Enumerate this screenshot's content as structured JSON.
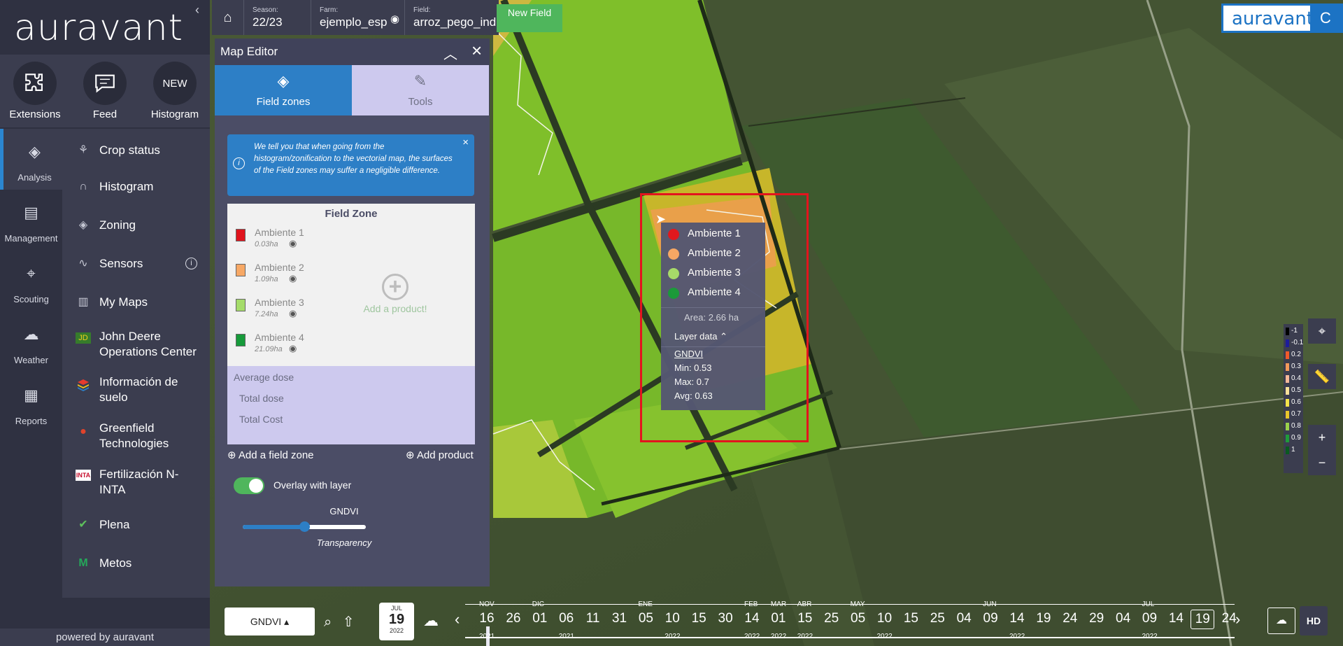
{
  "app": {
    "logo": "auravant",
    "powered_by": "powered by auravant"
  },
  "top_tools": [
    {
      "label": "Extensions",
      "icon": "puzzle-icon"
    },
    {
      "label": "Feed",
      "icon": "chat-icon"
    },
    {
      "label": "Histogram",
      "badge": "NEW"
    }
  ],
  "nav": [
    {
      "label": "Analysis",
      "icon": "layers-icon"
    },
    {
      "label": "Management",
      "icon": "book-icon"
    },
    {
      "label": "Scouting",
      "icon": "pin-icon"
    },
    {
      "label": "Weather",
      "icon": "cloud-icon"
    },
    {
      "label": "Reports",
      "icon": "clipboard-icon"
    }
  ],
  "menu": [
    {
      "label": "Crop status",
      "icon": "sprout-icon"
    },
    {
      "label": "Histogram",
      "icon": "curve-icon"
    },
    {
      "label": "Zoning",
      "icon": "layers-icon"
    },
    {
      "label": "Sensors",
      "icon": "pulse-icon"
    },
    {
      "label": "My Maps",
      "icon": "map-icon"
    },
    {
      "label": "John Deere Operations Center",
      "icon": "john-deere-icon"
    },
    {
      "label": "Información de suelo",
      "icon": "soil-layers-icon"
    },
    {
      "label": "Greenfield Technologies",
      "icon": "greenfield-icon"
    },
    {
      "label": "Fertilización N-INTA",
      "icon": "inta-icon"
    },
    {
      "label": "Plena",
      "icon": "check-circle-icon"
    },
    {
      "label": "Metos",
      "icon": "metos-icon"
    }
  ],
  "topbar": {
    "season_label": "Season:",
    "season": "22/23",
    "farm_label": "Farm:",
    "farm": "ejemplo_esp",
    "field_label": "Field:",
    "field": "arroz_pego_ind",
    "new_field": "New Field"
  },
  "brand": {
    "text": "auravant",
    "letter": "C"
  },
  "editor": {
    "title": "Map Editor",
    "tabs": [
      {
        "label": "Field zones"
      },
      {
        "label": "Tools"
      }
    ],
    "notice": "We tell you that when going from the histogram/zonification to the vectorial map, the surfaces of the Field zones may suffer a negligible difference.",
    "table_header": "Field Zone",
    "zones": [
      {
        "name": "Ambiente 1",
        "area": "0.03ha",
        "color": "#e0141d"
      },
      {
        "name": "Ambiente 2",
        "area": "1.09ha",
        "color": "#f7a865"
      },
      {
        "name": "Ambiente 3",
        "area": "7.24ha",
        "color": "#a5dc6a"
      },
      {
        "name": "Ambiente 4",
        "area": "21.09ha",
        "color": "#169a3a"
      }
    ],
    "add_product_center": "Add a product!",
    "average_dose": "Average dose",
    "total_dose": "Total dose",
    "total_cost": "Total Cost",
    "add_zone": "Add a field zone",
    "add_product": "Add product",
    "overlay": "Overlay with layer",
    "layer": "GNDVI",
    "transparency": "Transparency",
    "transparency_value": 0.5
  },
  "popup": {
    "zones": [
      {
        "name": "Ambiente 1",
        "color": "#e0141d"
      },
      {
        "name": "Ambiente 2",
        "color": "#f7a865"
      },
      {
        "name": "Ambiente 3",
        "color": "#a5dc6a"
      },
      {
        "name": "Ambiente 4",
        "color": "#169a3a"
      }
    ],
    "area_label": "Area:",
    "area_value": "2.66 ha",
    "layer_data": "Layer data",
    "index": "GNDVI",
    "min": "Min: 0.53",
    "max": "Max: 0.7",
    "avg": "Avg: 0.63"
  },
  "legend": [
    {
      "v": "-1",
      "c": "#000000"
    },
    {
      "v": "-0.1",
      "c": "#1d1d9a"
    },
    {
      "v": "0.2",
      "c": "#f05a2a"
    },
    {
      "v": "0.3",
      "c": "#f39a5a"
    },
    {
      "v": "0.4",
      "c": "#f5b99a"
    },
    {
      "v": "0.5",
      "c": "#f9e19a"
    },
    {
      "v": "0.6",
      "c": "#f3e34a"
    },
    {
      "v": "0.7",
      "c": "#e8c62a"
    },
    {
      "v": "0.8",
      "c": "#9ad24a"
    },
    {
      "v": "0.9",
      "c": "#1f9b3a"
    },
    {
      "v": "1",
      "c": "#0a5a20"
    }
  ],
  "bottom": {
    "layer": "GNDVI ▴",
    "date_month": "JUL",
    "date_day": "19",
    "date_year": "2022",
    "hd": "HD"
  },
  "timeline": {
    "days": [
      "16",
      "26",
      "01",
      "06",
      "11",
      "31",
      "05",
      "10",
      "15",
      "30",
      "14",
      "01",
      "15",
      "25",
      "05",
      "10",
      "15",
      "25",
      "04",
      "09",
      "14",
      "19",
      "24",
      "29",
      "04",
      "09",
      "14",
      "19",
      "24"
    ],
    "selected_index": 27,
    "months": [
      {
        "label": "NOV",
        "at": 0
      },
      {
        "label": "DIC",
        "at": 2
      },
      {
        "label": "ENE",
        "at": 6
      },
      {
        "label": "FEB",
        "at": 10
      },
      {
        "label": "MAR",
        "at": 11
      },
      {
        "label": "ABR",
        "at": 12
      },
      {
        "label": "MAY",
        "at": 14
      },
      {
        "label": "JUN",
        "at": 19
      },
      {
        "label": "JUL",
        "at": 25
      }
    ],
    "years": [
      {
        "label": "2021",
        "at": 0
      },
      {
        "label": "2021",
        "at": 3
      },
      {
        "label": "2022",
        "at": 7
      },
      {
        "label": "2022",
        "at": 10
      },
      {
        "label": "2022",
        "at": 11
      },
      {
        "label": "2022",
        "at": 12
      },
      {
        "label": "2022",
        "at": 15
      },
      {
        "label": "2022",
        "at": 20
      },
      {
        "label": "2022",
        "at": 25
      }
    ]
  }
}
